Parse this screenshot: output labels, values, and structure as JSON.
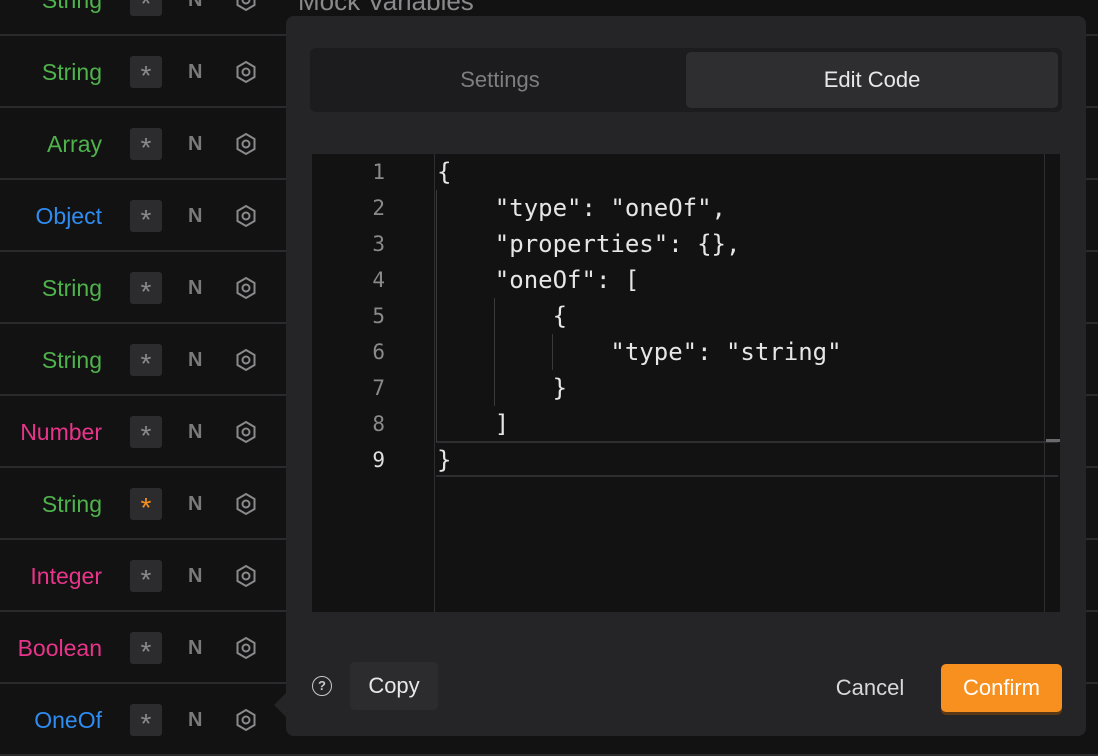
{
  "background_title": "Mock Variables",
  "colors": {
    "string": "#4fb34c",
    "object": "#2f8cf0",
    "number": "#e8348a",
    "accent": "#f7901e"
  },
  "rows": [
    {
      "type": "String",
      "color": "#4fb34c",
      "required": false,
      "nullable_label": "N"
    },
    {
      "type": "String",
      "color": "#4fb34c",
      "required": false,
      "nullable_label": "N"
    },
    {
      "type": "Array",
      "color": "#4fb34c",
      "required": false,
      "nullable_label": "N"
    },
    {
      "type": "Object",
      "color": "#2f8cf0",
      "required": false,
      "nullable_label": "N"
    },
    {
      "type": "String",
      "color": "#4fb34c",
      "required": false,
      "nullable_label": "N"
    },
    {
      "type": "String",
      "color": "#4fb34c",
      "required": false,
      "nullable_label": "N"
    },
    {
      "type": "Number",
      "color": "#e8348a",
      "required": false,
      "nullable_label": "N"
    },
    {
      "type": "String",
      "color": "#4fb34c",
      "required": true,
      "nullable_label": "N"
    },
    {
      "type": "Integer",
      "color": "#e8348a",
      "required": false,
      "nullable_label": "N"
    },
    {
      "type": "Boolean",
      "color": "#e8348a",
      "required": false,
      "nullable_label": "N"
    },
    {
      "type": "OneOf",
      "color": "#2f8cf0",
      "required": false,
      "nullable_label": "N"
    }
  ],
  "popover": {
    "tabs": [
      {
        "label": "Settings",
        "active": false
      },
      {
        "label": "Edit Code",
        "active": true
      }
    ],
    "editor": {
      "current_line": 9,
      "lines": [
        {
          "n": "1",
          "text": "{"
        },
        {
          "n": "2",
          "text": "    \"type\": \"oneOf\","
        },
        {
          "n": "3",
          "text": "    \"properties\": {},"
        },
        {
          "n": "4",
          "text": "    \"oneOf\": ["
        },
        {
          "n": "5",
          "text": "        {"
        },
        {
          "n": "6",
          "text": "            \"type\": \"string\""
        },
        {
          "n": "7",
          "text": "        }"
        },
        {
          "n": "8",
          "text": "    ]"
        },
        {
          "n": "9",
          "text": "}"
        }
      ]
    },
    "footer": {
      "help_icon": "question-circle",
      "copy": "Copy",
      "cancel": "Cancel",
      "confirm": "Confirm"
    }
  }
}
